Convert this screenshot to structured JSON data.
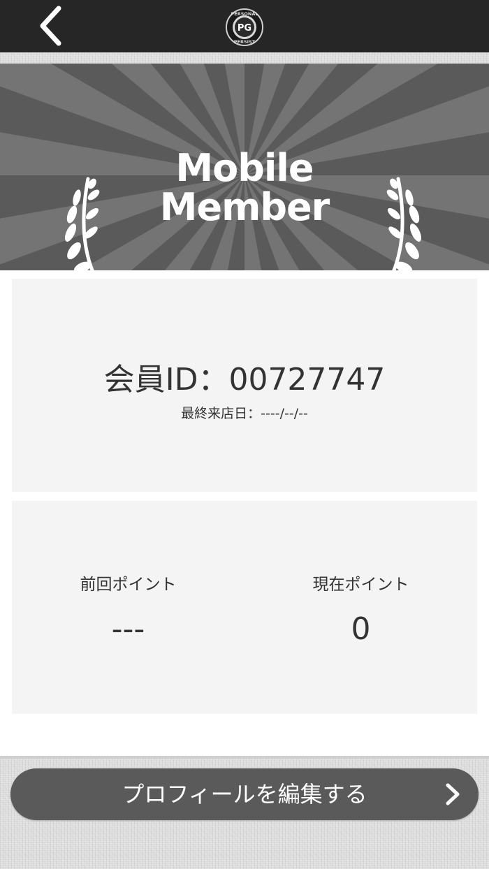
{
  "header": {
    "back_icon": "chevron-left-icon",
    "logo": {
      "top_text": "PERSONAL",
      "monogram": "PG",
      "bottom_text": "PERSIST"
    }
  },
  "banner": {
    "line1": "Mobile",
    "line2": "Member",
    "left_icon": "laurel-icon",
    "right_icon": "laurel-icon"
  },
  "member_card": {
    "member_id": "会員ID：00727747",
    "last_visit": "最終来店日：----/--/--"
  },
  "points_card": {
    "previous": {
      "label": "前回ポイント",
      "value": "---"
    },
    "current": {
      "label": "現在ポイント",
      "value": "0"
    }
  },
  "profile_button": {
    "label": "プロフィールを編集する",
    "icon": "chevron-right-icon"
  },
  "colors": {
    "topbar": "#262626",
    "banner": "#5a5a5a",
    "card": "#f4f4f4",
    "button": "#5a5a5a",
    "text": "#333333"
  }
}
